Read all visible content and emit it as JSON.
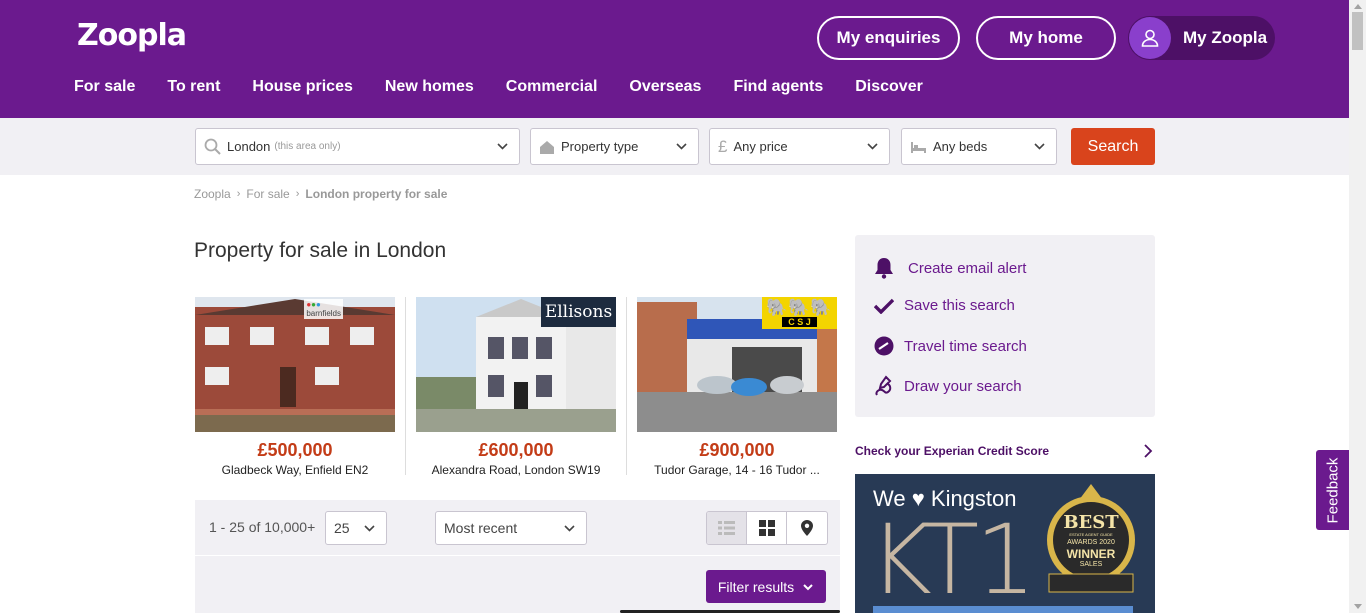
{
  "header": {
    "logo": "Zoopla",
    "buttons": {
      "enquiries": "My enquiries",
      "home": "My home",
      "my_zoopla": "My Zoopla"
    },
    "nav": [
      "For sale",
      "To rent",
      "House prices",
      "New homes",
      "Commercial",
      "Overseas",
      "Find agents",
      "Discover"
    ]
  },
  "search": {
    "location": "London",
    "location_hint": "(this area only)",
    "property_type": "Property type",
    "price": "Any price",
    "beds": "Any beds",
    "button": "Search"
  },
  "breadcrumb": [
    "Zoopla",
    "For sale",
    "London property for sale"
  ],
  "page_title": "Property for sale in London",
  "featured": [
    {
      "price": "£500,000",
      "address": "Gladbeck Way, Enfield EN2",
      "agent": "barnfields"
    },
    {
      "price": "£600,000",
      "address": "Alexandra Road, London SW19",
      "agent": "Ellisons"
    },
    {
      "price": "£900,000",
      "address": "Tudor Garage, 14 - 16 Tudor ...",
      "agent": "C S J"
    }
  ],
  "results": {
    "count": "1 - 25 of 10,000+",
    "per_page": "25",
    "sort": "Most recent",
    "filter": "Filter results"
  },
  "sidebar": {
    "actions": [
      "Create email alert",
      "Save this search",
      "Travel time search",
      "Draw your search"
    ],
    "experian": "Check your Experian Credit Score",
    "ad": {
      "headline": "We ♥ Kingston",
      "big": "KT1",
      "badge_top": "BEST",
      "badge_sub": "ESTATE AGENT GUIDE",
      "badge_awards": "AWARDS 2020",
      "badge_winner": "WINNER",
      "badge_cat": "SALES"
    }
  },
  "feedback": "Feedback",
  "colors": {
    "brand": "#6b1a8e",
    "search_button": "#d9441c",
    "price": "#c33c17"
  }
}
